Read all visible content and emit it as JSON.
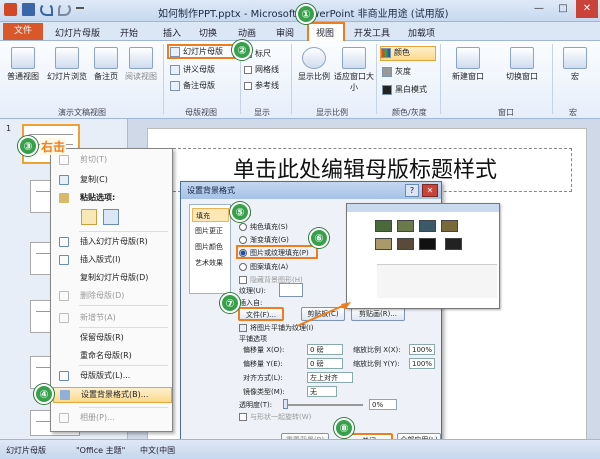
{
  "window": {
    "title": "如何制作PPT.pptx - Microsoft PowerPoint 非商业用途 (试用版)",
    "controls": [
      "—",
      "□",
      "✕"
    ]
  },
  "tabs": {
    "file": "文件",
    "items": [
      "幻灯片母版",
      "开始",
      "插入",
      "切换",
      "动画",
      "审阅",
      "视图",
      "开发工具",
      "加载项"
    ]
  },
  "ribbon": {
    "views": {
      "normal": "普通视图",
      "sorter": "幻灯片浏览",
      "notes": "备注页",
      "reading": "阅读视图",
      "group": "演示文稿视图"
    },
    "master": {
      "slide_master": "幻灯片母版",
      "handout": "讲义母版",
      "notes_master": "备注母版",
      "group": "母版视图"
    },
    "show": {
      "ruler": "标尺",
      "grid": "网格线",
      "guides": "参考线",
      "group": "显示"
    },
    "zoom": {
      "zoom": "显示比例",
      "fit": "适应窗口大小",
      "group": "显示比例"
    },
    "color": {
      "color": "颜色",
      "gray": "灰度",
      "bw": "黑白模式",
      "group": "颜色/灰度"
    },
    "window": {
      "new": "新建窗口",
      "switch": "切换窗口",
      "group": "窗口"
    },
    "macro": {
      "macro": "宏",
      "group": "宏"
    }
  },
  "thumbnails": {
    "first_number": "1",
    "right_click": "右击"
  },
  "slide": {
    "title_placeholder": "单击此处编辑母版标题样式"
  },
  "context_menu": {
    "items": [
      {
        "label": "剪切(T)",
        "disabled": true
      },
      {
        "label": "复制(C)",
        "disabled": false
      },
      {
        "label": "粘贴选项:",
        "disabled": false
      },
      {
        "label": "插入幻灯片母版(R)",
        "disabled": false
      },
      {
        "label": "插入版式(I)",
        "disabled": false
      },
      {
        "label": "复制幻灯片母版(D)",
        "disabled": false
      },
      {
        "label": "删除母版(D)",
        "disabled": true
      },
      {
        "label": "新增节(A)",
        "disabled": true
      },
      {
        "label": "保留母版(R)",
        "disabled": false
      },
      {
        "label": "重命名母版(R)",
        "disabled": false
      },
      {
        "label": "母版版式(L)...",
        "disabled": false
      },
      {
        "label": "设置背景格式(B)...",
        "disabled": false
      },
      {
        "label": "相册(P)...",
        "disabled": true
      }
    ]
  },
  "dialog": {
    "title": "设置背景格式",
    "nav": [
      "填充",
      "图片更正",
      "图片颜色",
      "艺术效果"
    ],
    "section": "填充",
    "options": [
      "纯色填充(S)",
      "渐变填充(G)",
      "图片或纹理填充(P)",
      "图案填充(A)"
    ],
    "hide_bg": "隐藏背景图形(H)",
    "texture": "纹理(U):",
    "insert_from": "插入自:",
    "file_btn": "文件(F)...",
    "clipboard_btn": "剪贴板(C)",
    "clipart_btn": "剪贴画(R)...",
    "tile": "将图片平铺为纹理(I)",
    "tile_options": "平铺选项",
    "offset_x": "偏移量 X(O):",
    "offset_x_val": "0 磅",
    "scale_x": "缩放比例 X(X):",
    "scale_x_val": "100%",
    "offset_y": "偏移量 Y(E):",
    "offset_y_val": "0 磅",
    "scale_y": "缩放比例 Y(Y):",
    "scale_y_val": "100%",
    "align": "对齐方式(L):",
    "align_val": "左上对齐",
    "mirror": "镜像类型(M):",
    "mirror_val": "无",
    "transparency": "透明度(T):",
    "transparency_val": "0%",
    "rotate": "与形状一起旋转(W)",
    "reset_btn": "重置背景(B)",
    "close_btn": "关闭",
    "apply_all_btn": "全部应用(L)"
  },
  "steps": [
    "①",
    "②",
    "③",
    "④",
    "⑤",
    "⑥",
    "⑦",
    "⑧"
  ],
  "status": {
    "view": "幻灯片母版",
    "theme": "\"Office 主题\"",
    "lang": "中文(中国"
  },
  "colors": {
    "accent": "#ef7d1d",
    "step_badge": "#36a04a",
    "file_tab": "#d9572b"
  }
}
